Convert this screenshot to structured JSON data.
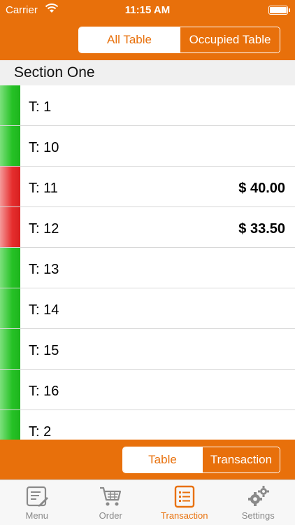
{
  "status_bar": {
    "carrier": "Carrier",
    "time": "11:15 AM"
  },
  "top_filter": {
    "options": [
      "All Table",
      "Occupied Table"
    ],
    "selected": "All Table"
  },
  "section": {
    "title": "Section One"
  },
  "tables": [
    {
      "name": "T: 1",
      "status": "available",
      "amount": ""
    },
    {
      "name": "T: 10",
      "status": "available",
      "amount": ""
    },
    {
      "name": "T: 11",
      "status": "occupied",
      "amount": "$ 40.00"
    },
    {
      "name": "T: 12",
      "status": "occupied",
      "amount": "$ 33.50"
    },
    {
      "name": "T: 13",
      "status": "available",
      "amount": ""
    },
    {
      "name": "T: 14",
      "status": "available",
      "amount": ""
    },
    {
      "name": "T: 15",
      "status": "available",
      "amount": ""
    },
    {
      "name": "T: 16",
      "status": "available",
      "amount": ""
    },
    {
      "name": "T: 2",
      "status": "available",
      "amount": ""
    }
  ],
  "bottom_toggle": {
    "options": [
      "Table",
      "Transaction"
    ],
    "selected": "Table"
  },
  "tab_bar": {
    "items": [
      {
        "label": "Menu",
        "icon": "menu-icon"
      },
      {
        "label": "Order",
        "icon": "cart-icon"
      },
      {
        "label": "Transaction",
        "icon": "list-icon"
      },
      {
        "label": "Settings",
        "icon": "gears-icon"
      }
    ],
    "selected": "Transaction"
  },
  "colors": {
    "accent": "#E8700B",
    "available": "#26C126",
    "occupied": "#E52E2E"
  }
}
